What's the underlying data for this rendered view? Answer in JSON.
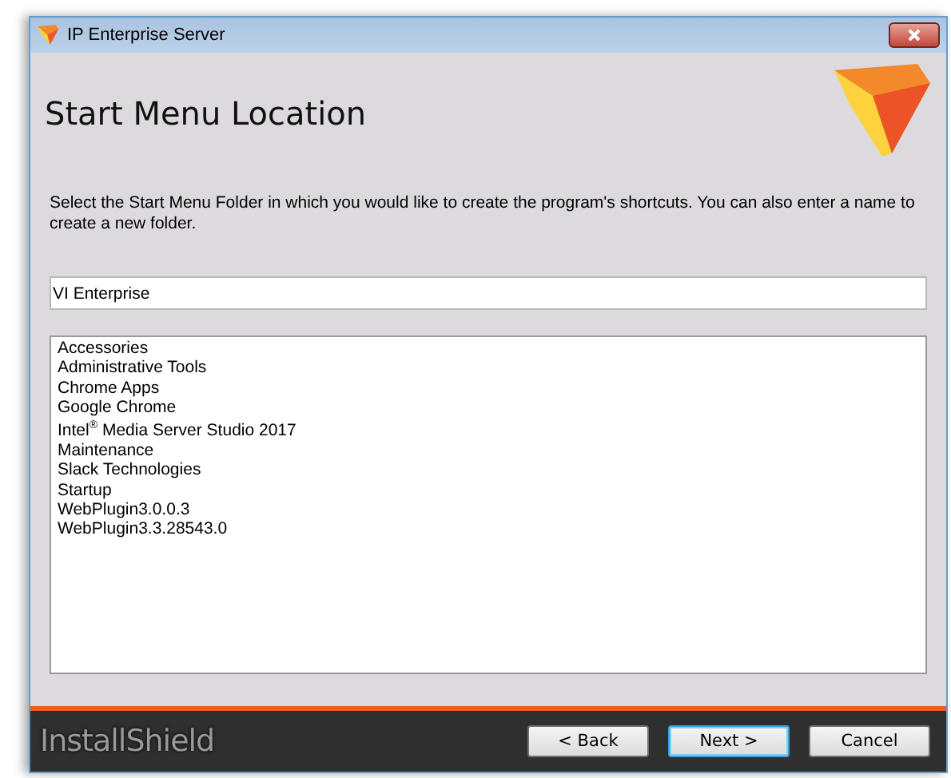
{
  "window": {
    "title": "IP Enterprise Server"
  },
  "header": {
    "title": "Start Menu Location"
  },
  "description": "Select the Start Menu Folder in which you would like to create the program's shortcuts. You can also enter a name to create a new folder.",
  "folder_field": {
    "value": "VI Enterprise"
  },
  "folders": [
    {
      "label": "Accessories"
    },
    {
      "label": "Administrative Tools"
    },
    {
      "label": "Chrome Apps"
    },
    {
      "label": "Google Chrome"
    },
    {
      "label": "Intel$^{®}$ Media Server Studio 2017"
    },
    {
      "label": "Maintenance"
    },
    {
      "label": "Slack Technologies"
    },
    {
      "label": "Startup"
    },
    {
      "label": "WebPlugin3.0.0.3"
    },
    {
      "label": "WebPlugin3.3.28543.0"
    }
  ],
  "footer": {
    "brand": "InstallShield",
    "buttons": [
      {
        "label": "< Back",
        "default": false
      },
      {
        "label": "Next >",
        "default": true
      },
      {
        "label": "Cancel",
        "default": false
      }
    ]
  }
}
